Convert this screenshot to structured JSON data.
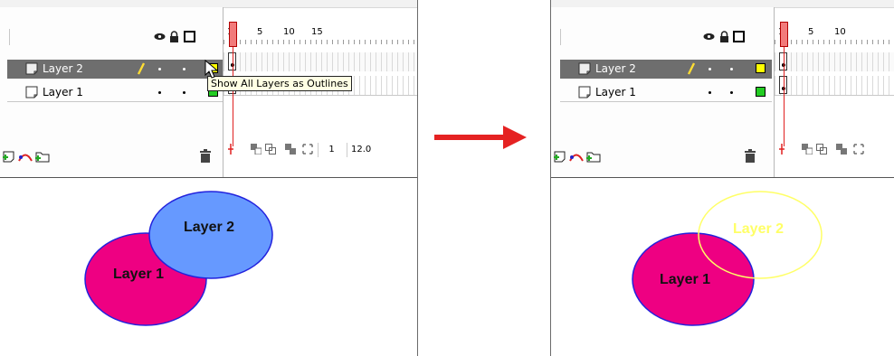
{
  "left_panel": {
    "layers": [
      {
        "name": "Layer 2",
        "selected": true,
        "outline_color": "#ffff00"
      },
      {
        "name": "Layer 1",
        "selected": false,
        "outline_color": "#22cc22"
      }
    ],
    "frame_numbers": [
      "1",
      "5",
      "10",
      "15"
    ],
    "current_frame": "1",
    "frame_rate": "12.0",
    "tooltip": "Show All Layers as Outlines",
    "stage": {
      "layer1_label": "Layer 1",
      "layer2_label": "Layer 2",
      "layer1_fill": "#ee0082",
      "layer2_fill": "#6699ff",
      "stroke": "#2222dd"
    }
  },
  "right_panel": {
    "layers": [
      {
        "name": "Layer 2",
        "selected": true,
        "outline_color": "#ffff00"
      },
      {
        "name": "Layer 1",
        "selected": false,
        "outline_color": "#22cc22"
      }
    ],
    "frame_numbers": [
      "1",
      "5",
      "10"
    ],
    "stage": {
      "layer1_label": "Layer 1",
      "layer2_label": "Layer 2",
      "layer1_fill": "#ee0082",
      "layer2_outline": "#ffff66",
      "stroke": "#2222dd"
    }
  },
  "arrow_color": "#e52222",
  "icons": {
    "eye": "eye-icon",
    "lock": "lock-icon",
    "outline": "outline-icon",
    "layer": "layer-icon",
    "pencil": "pencil-icon",
    "trash": "trash-icon",
    "add_layer": "add-layer-icon",
    "add_guide": "add-motion-guide-icon",
    "add_folder": "add-folder-icon"
  }
}
